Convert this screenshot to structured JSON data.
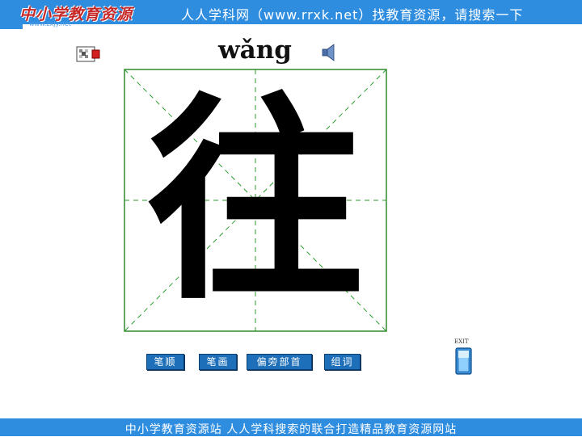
{
  "header": {
    "logo_text": "中小学教育资源",
    "logo_sub": "www.zxjy.net",
    "banner_text": "人人学科网（www.rrxk.net）找教育资源，请搜索一下"
  },
  "lesson": {
    "pinyin": "wǎng",
    "character": "往"
  },
  "toolbar": {
    "stroke_order": "笔顺",
    "strokes": "笔画",
    "radical": "偏旁部首",
    "words": "组词"
  },
  "exit": {
    "label": "EXIT"
  },
  "footer": {
    "text": "中小学教育资源站 人人学科搜索的联合打造精品教育资源网站"
  },
  "colors": {
    "banner": "#2f8de0",
    "grid_border": "#2e8b2e",
    "grid_dash": "#2e9a2e",
    "button": "#1c6fb8"
  },
  "icons": {
    "hint": "puzzle-icon",
    "audio": "speaker-icon",
    "exit": "exit-door-icon"
  }
}
